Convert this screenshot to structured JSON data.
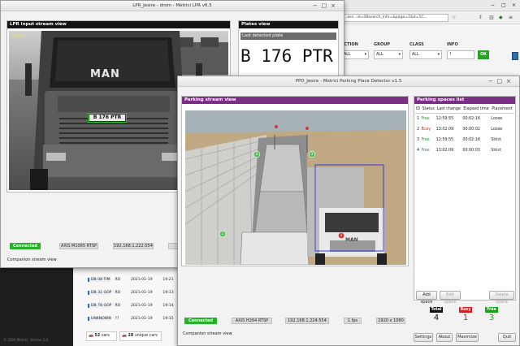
{
  "lpr_window": {
    "title": "LPR_Jesire - drom - Metrici LPR v6.5",
    "input_panel_title": "LPR input stream view",
    "overlay_lines": [
      "TRACKER: ...",
      "...",
      "..."
    ],
    "truck_brand": "MAN",
    "detected_plate_on_truck": "B 176 PTR",
    "status": "Connected",
    "source": "AXIS M1065 RTSP",
    "ip": "192.168.1.222:554",
    "companion_label": "Companion stream view",
    "plates_view_title": "Plates view",
    "last_detected_label": "Last detected plate",
    "last_detected_plate": "B 176 PTR"
  },
  "browser": {
    "url": "...ass...id=08search_info=&page=1&d=1C...",
    "filters": [
      {
        "label": "ECTION",
        "value": "ALL"
      },
      {
        "label": "GROUP",
        "value": "ALL"
      },
      {
        "label": "CLASS",
        "value": "ALL"
      },
      {
        "label": "INFO",
        "value": "?"
      }
    ],
    "ok_label": "OK"
  },
  "bg_table": {
    "rows": [
      {
        "plate": "DB 08 TIM",
        "code": "RO",
        "date": "2021-01-19",
        "time": "19:21"
      },
      {
        "plate": "DB 31 GOP",
        "code": "RO",
        "date": "2021-01-19",
        "time": "19:13"
      },
      {
        "plate": "DB 78 GOP",
        "code": "RO",
        "date": "2021-01-19",
        "time": "19:14"
      },
      {
        "plate": "UNKNOWN",
        "code": "??",
        "date": "2021-01-19",
        "time": "19:15"
      }
    ],
    "cars_count": "52",
    "cars_label": "cars",
    "unique_count": "28",
    "unique_label": "unique cars",
    "footer": "© 2020 Metrici. Version 3.4"
  },
  "ppd_window": {
    "title": "PPD_Jesire - Metrici Parking Place Detector v1.5",
    "stream_title": "Parking stream view",
    "list_title": "Parking spaces list",
    "columns": [
      "ID",
      "Status",
      "Last change",
      "Elapsed time",
      "Placement"
    ],
    "spaces": [
      {
        "id": "1",
        "status": "Free",
        "last_change": "12:59:55",
        "elapsed": "00:02:16",
        "placement": "Loose"
      },
      {
        "id": "2",
        "status": "Busy",
        "last_change": "13:02:09",
        "elapsed": "00:00:02",
        "placement": "Loose"
      },
      {
        "id": "3",
        "status": "Free",
        "last_change": "12:59:55",
        "elapsed": "00:02:16",
        "placement": "Strict"
      },
      {
        "id": "4",
        "status": "Free",
        "last_change": "13:02:09",
        "elapsed": "00:00:03",
        "placement": "Strict"
      }
    ],
    "add_space": "Add space",
    "edit_space": "Edit space",
    "delete_space": "Delete space",
    "total_label": "Total",
    "busy_label": "Busy",
    "free_label": "Free",
    "total_value": "4",
    "busy_value": "1",
    "free_value": "3",
    "status": "Connected",
    "source": "AXIS H264 RTSP",
    "ip": "192.168.1.224:554",
    "fps": "1 fps",
    "resolution": "1920 x 1080",
    "companion_label": "Companion stream view",
    "buttons": [
      "Settings",
      "About",
      "Maximize",
      "Quit"
    ],
    "markers": [
      "1",
      "2",
      "3",
      "4"
    ]
  },
  "colors": {
    "panel_purple": "#7b2e85",
    "connected_green": "#26b226",
    "free_green": "#1c9a1c",
    "busy_red": "#d21e1e",
    "ok_green": "#2ba12b",
    "link_blue": "#2f6fb0"
  }
}
